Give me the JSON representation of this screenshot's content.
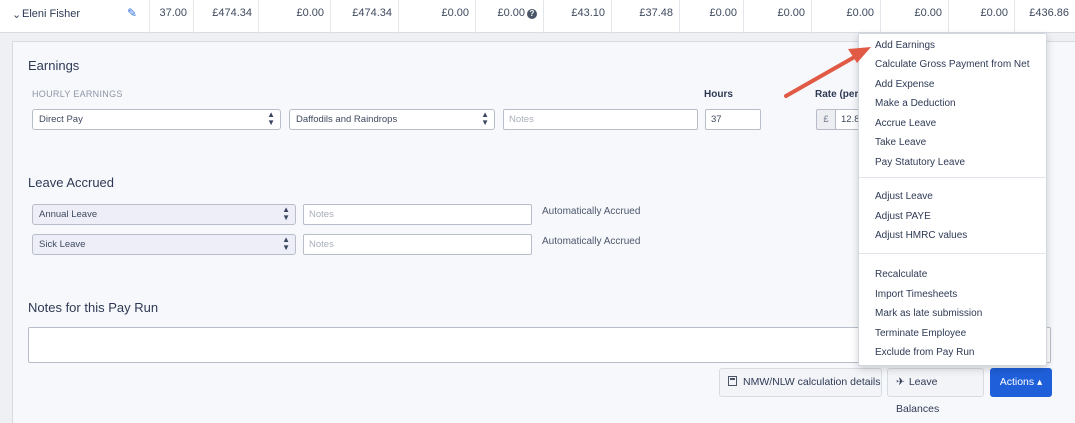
{
  "employee_row": {
    "name": "Eleni Fisher",
    "chevron_icon": "chevron-down-icon",
    "edit_icon": "pencil-icon",
    "cells": [
      "37.00",
      "£474.34",
      "£0.00",
      "£474.34",
      "£0.00",
      "£0.00",
      "£43.10",
      "£37.48",
      "£0.00",
      "£0.00",
      "£0.00",
      "£0.00",
      "£0.00",
      "£436.86"
    ],
    "info_icon": "question-icon"
  },
  "earnings": {
    "title": "Earnings",
    "subheading": "HOURLY EARNINGS",
    "hours_label": "Hours",
    "rate_label": "Rate (per",
    "type_value": "Direct Pay",
    "project_value": "Daffodils and Raindrops",
    "notes_placeholder": "Notes",
    "hours_value": "37",
    "currency_prefix": "£",
    "rate_value": "12.8"
  },
  "leave": {
    "title": "Leave Accrued",
    "rows": [
      {
        "type": "Annual Leave",
        "notes_placeholder": "Notes",
        "status": "Automatically Accrued"
      },
      {
        "type": "Sick Leave",
        "notes_placeholder": "Notes",
        "status": "Automatically Accrued"
      }
    ]
  },
  "notes": {
    "title": "Notes for this Pay Run",
    "value": ""
  },
  "buttons": {
    "nmw": "NMW/NLW calculation details",
    "leave_balances": "Leave Balances",
    "actions": "Actions ▴"
  },
  "actions_menu": {
    "groups": [
      [
        "Add Earnings",
        "Calculate Gross Payment from Net",
        "Add Expense",
        "Make a Deduction",
        "Accrue Leave",
        "Take Leave",
        "Pay Statutory Leave"
      ],
      [
        "Adjust Leave",
        "Adjust PAYE",
        "Adjust HMRC values"
      ],
      [
        "Recalculate",
        "Import Timesheets",
        "Mark as late submission",
        "Terminate Employee",
        "Exclude from Pay Run"
      ]
    ]
  },
  "colors": {
    "primary": "#1f5fd9",
    "annotation_arrow": "#e05a45"
  }
}
